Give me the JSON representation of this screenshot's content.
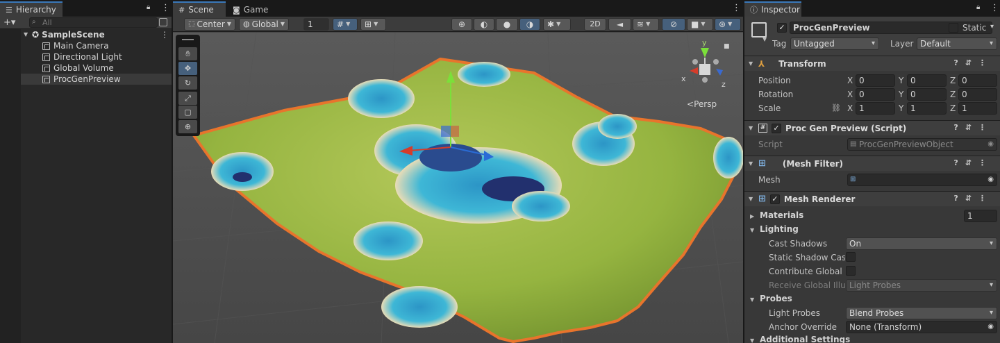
{
  "hierarchy": {
    "tab_label": "Hierarchy",
    "search_placeholder": "All",
    "add_label": "+▾",
    "scene_name": "SampleScene",
    "items": [
      {
        "label": "Main Camera"
      },
      {
        "label": "Directional Light"
      },
      {
        "label": "Global Volume"
      },
      {
        "label": "ProcGenPreview"
      }
    ]
  },
  "scene_view": {
    "tabs": [
      {
        "label": "Scene"
      },
      {
        "label": "Game"
      }
    ],
    "pivot_mode": "Center",
    "pivot_rotation": "Global",
    "grid_snap_value": "1",
    "mode_2d": "2D",
    "gizmo_persp_label": "Persp",
    "gizmo_axes": {
      "x": "x",
      "y": "y",
      "z": "z"
    },
    "colors": {
      "terrain_edge": "#e8742c",
      "grass": "#95b440",
      "water": "#3eb7d6",
      "deep_water": "#22306e",
      "sand": "#e9dcb6"
    }
  },
  "inspector": {
    "tab_label": "Inspector",
    "object_name": "ProcGenPreview",
    "static_label": "Static",
    "tag_label": "Tag",
    "tag_value": "Untagged",
    "layer_label": "Layer",
    "layer_value": "Default",
    "transform": {
      "title": "Transform",
      "position_label": "Position",
      "rotation_label": "Rotation",
      "scale_label": "Scale",
      "axis_x": "X",
      "axis_y": "Y",
      "axis_z": "Z",
      "position": {
        "x": "0",
        "y": "0",
        "z": "0"
      },
      "rotation": {
        "x": "0",
        "y": "0",
        "z": "0"
      },
      "scale": {
        "x": "1",
        "y": "1",
        "z": "1"
      }
    },
    "script_component": {
      "title": "Proc Gen Preview (Script)",
      "script_label": "Script",
      "script_value": "ProcGenPreviewObject"
    },
    "mesh_filter": {
      "title": "(Mesh Filter)",
      "mesh_label": "Mesh",
      "mesh_value": ""
    },
    "mesh_renderer": {
      "title": "Mesh Renderer",
      "materials_label": "Materials",
      "materials_count": "1",
      "lighting_label": "Lighting",
      "cast_shadows_label": "Cast Shadows",
      "cast_shadows_value": "On",
      "static_shadow_label": "Static Shadow Cast",
      "contribute_gi_label": "Contribute Global Il",
      "receive_gi_label": "Receive Global Illum",
      "receive_gi_value": "Light Probes",
      "probes_label": "Probes",
      "light_probes_label": "Light Probes",
      "light_probes_value": "Blend Probes",
      "anchor_override_label": "Anchor Override",
      "anchor_override_value": "None (Transform)",
      "additional_settings_label": "Additional Settings"
    }
  }
}
